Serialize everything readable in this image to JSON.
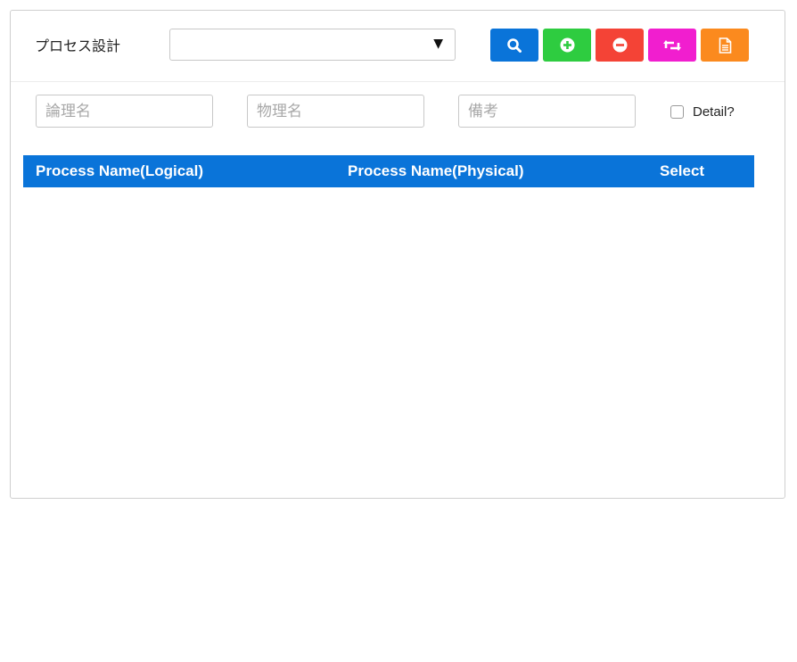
{
  "header": {
    "title": "プロセス設計",
    "dropdown": {
      "selected": "",
      "arrow": "▼"
    }
  },
  "toolbar": {
    "buttons": [
      {
        "icon": "search-icon",
        "color": "#0a74d9"
      },
      {
        "icon": "plus-circle-icon",
        "color": "#2ecc40"
      },
      {
        "icon": "minus-circle-icon",
        "color": "#f44336"
      },
      {
        "icon": "retweet-icon",
        "color": "#f11ecf"
      },
      {
        "icon": "document-icon",
        "color": "#fb8a1e"
      }
    ]
  },
  "filters": {
    "logical_name": {
      "placeholder": "論理名",
      "value": ""
    },
    "physical_name": {
      "placeholder": "物理名",
      "value": ""
    },
    "remarks": {
      "placeholder": "備考",
      "value": ""
    },
    "detail": {
      "label": "Detail?",
      "checked": false
    }
  },
  "table": {
    "header_color": "#0a74d9",
    "columns": [
      "Process Name(Logical)",
      "Process Name(Physical)",
      "Select"
    ],
    "rows": []
  }
}
